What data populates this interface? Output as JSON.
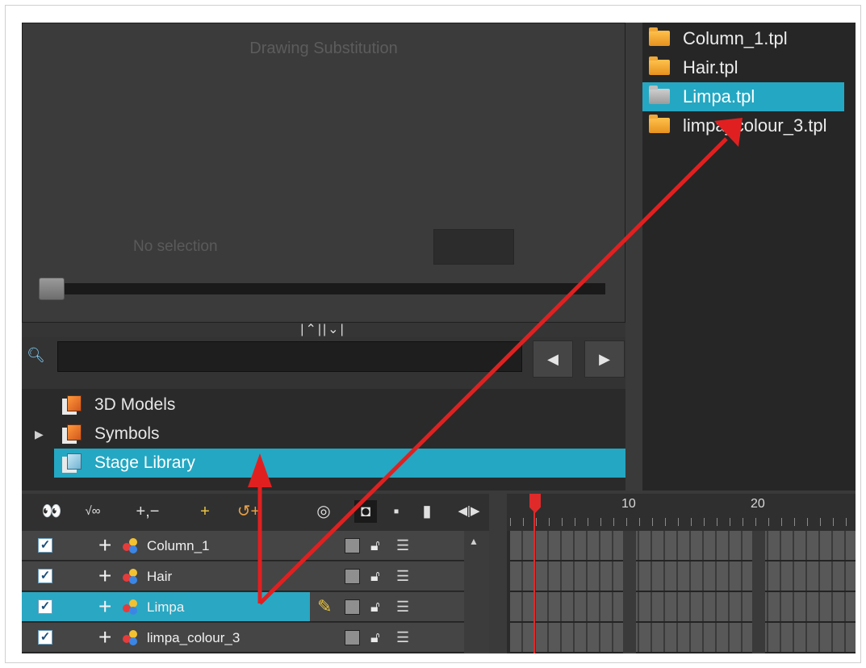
{
  "library_view": {
    "title": "Drawing Substitution",
    "status": "No selection"
  },
  "splitter": {
    "toggle": "|⌃||⌄|"
  },
  "search": {
    "placeholder": "",
    "prev": "◀",
    "next": "▶"
  },
  "library_tree": [
    {
      "label": "3D Models",
      "expanded": false
    },
    {
      "label": "Symbols",
      "expanded": false
    },
    {
      "label": "Stage Library",
      "selected": true
    }
  ],
  "templates": [
    {
      "label": "Column_1.tpl"
    },
    {
      "label": "Hair.tpl"
    },
    {
      "label": "Limpa.tpl",
      "selected": true
    },
    {
      "label": "limpa_colour_3.tpl"
    }
  ],
  "timeline": {
    "toolbar": [
      "👀",
      "√∞",
      "+,−",
      "+",
      "↺+",
      "◎",
      "◘",
      "▪",
      "▮",
      "◀|▶"
    ],
    "ruler": [
      "10",
      "20"
    ],
    "layers": [
      {
        "name": "Column_1",
        "checked": true
      },
      {
        "name": "Hair",
        "checked": true
      },
      {
        "name": "Limpa",
        "checked": true,
        "selected": true
      },
      {
        "name": "limpa_colour_3",
        "checked": true
      }
    ]
  },
  "colors": {
    "selection": "#24a7c2",
    "annotation": "#e02020"
  }
}
